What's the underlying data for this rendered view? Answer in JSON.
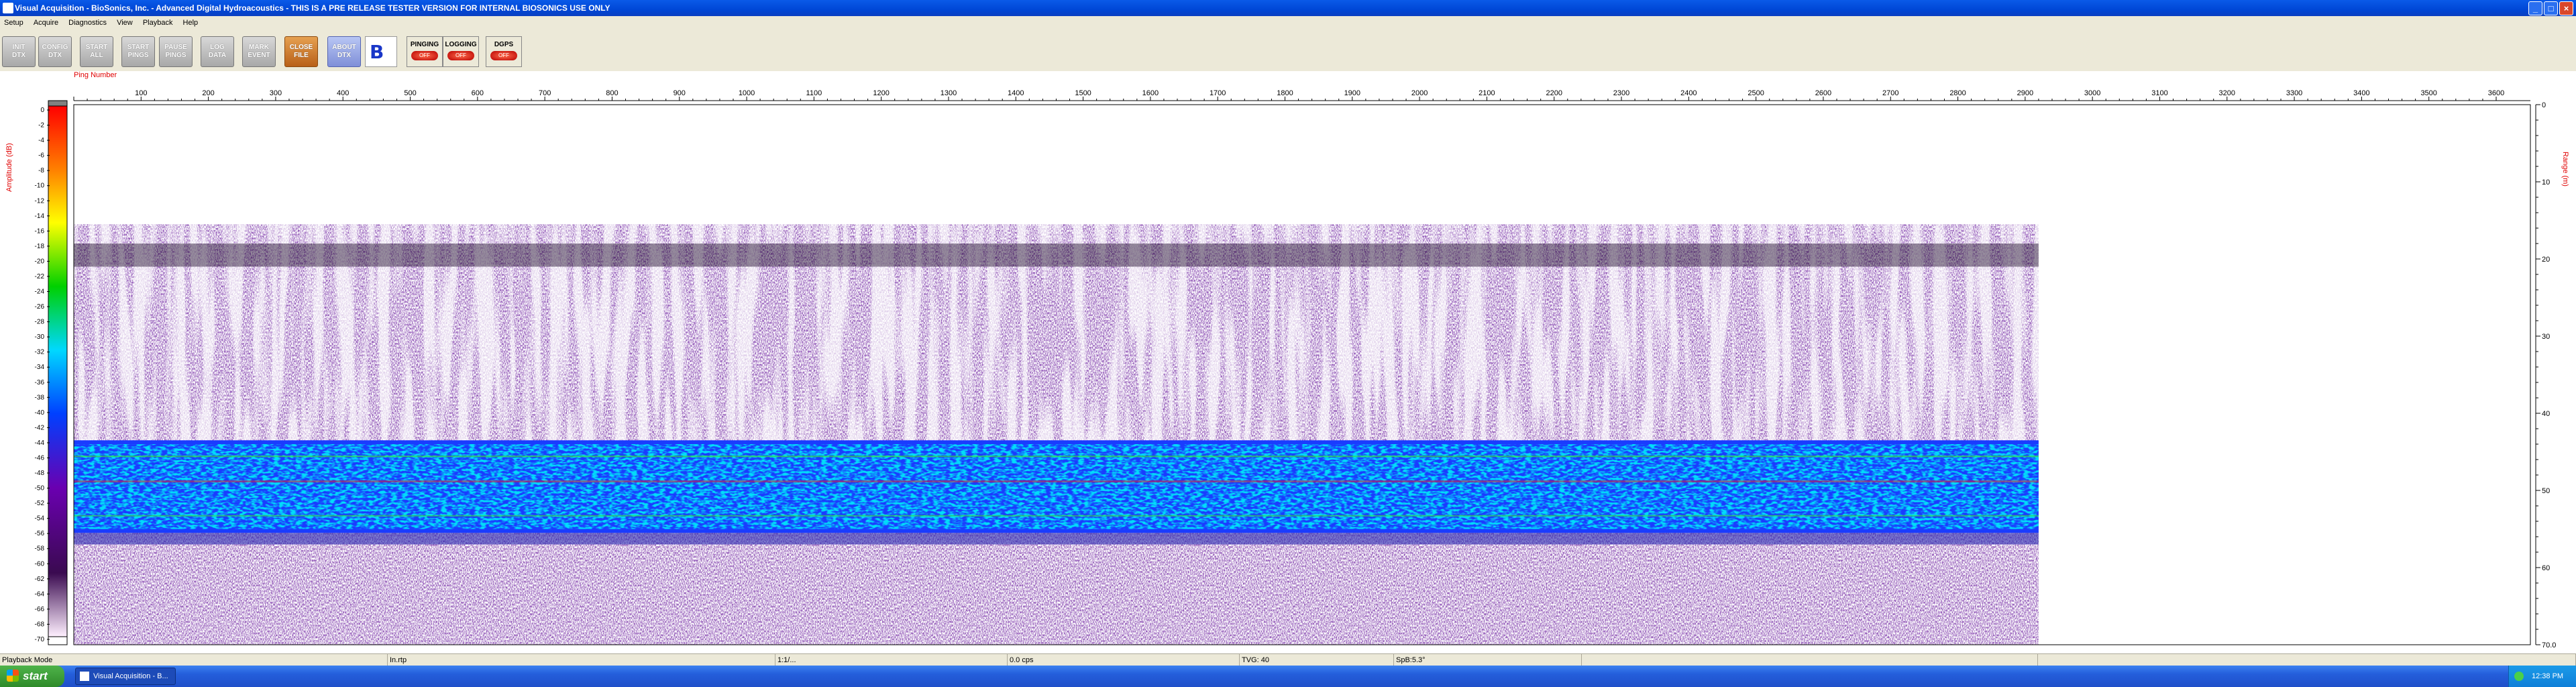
{
  "window": {
    "title": "Visual Acquisition  -  BioSonics, Inc.  -  Advanced Digital Hydroacoustics  -  THIS IS A PRE RELEASE TESTER VERSION FOR INTERNAL BIOSONICS USE ONLY",
    "buttons": {
      "minimize": "_",
      "maximize": "□",
      "close": "×"
    }
  },
  "menu": [
    "Setup",
    "Acquire",
    "Diagnostics",
    "View",
    "Playback",
    "Help"
  ],
  "toolbar": {
    "buttons": [
      "INIT\nDTX",
      "CONFIG\nDTX",
      "START\nALL",
      "START\nPINGS",
      "PAUSE\nPINGS",
      "LOG\nDATA",
      "MARK\nEVENT",
      "CLOSE\nFILE",
      "ABOUT\nDTX"
    ],
    "logo": "B",
    "status_buttons": [
      {
        "label": "PINGING",
        "state": "OFF"
      },
      {
        "label": "LOGGING",
        "state": "OFF"
      },
      {
        "label": "DGPS",
        "state": "OFF"
      }
    ]
  },
  "echogram": {
    "x_axis_title": "Ping Number",
    "x_ticks": [
      "100",
      "200",
      "300",
      "400",
      "500",
      "600",
      "700",
      "800",
      "900",
      "1000",
      "1100",
      "1200",
      "1300",
      "1400",
      "1500",
      "1600",
      "1700",
      "1800",
      "1900",
      "2000",
      "2100",
      "2200",
      "2300",
      "2400",
      "2500",
      "2600",
      "2700",
      "2800",
      "2900",
      "3000",
      "3100",
      "3200",
      "3300",
      "3400",
      "3500",
      "3600"
    ],
    "amplitude_title": "Amplitude (dB)",
    "amplitude_ticks": [
      "0",
      "-2",
      "-4",
      "-6",
      "-8",
      "-10",
      "-12",
      "-14",
      "-16",
      "-18",
      "-20",
      "-22",
      "-24",
      "-26",
      "-28",
      "-30",
      "-32",
      "-34",
      "-36",
      "-38",
      "-40",
      "-42",
      "-44",
      "-46",
      "-48",
      "-50",
      "-52",
      "-54",
      "-56",
      "-58",
      "-60",
      "-62",
      "-64",
      "-66",
      "-68",
      "-70"
    ],
    "range_title": "Range (m)",
    "range_ticks": [
      "0",
      "10",
      "20",
      "30",
      "40",
      "50",
      "60",
      "70.0"
    ],
    "colors": {
      "noise": "#4a1a7a",
      "band_blue": "#1a3cff",
      "band_cyan": "#00c8e8",
      "band_green": "#38e038",
      "band_red": "#d02040",
      "axis_label": "#e00000"
    }
  },
  "statusbar": {
    "mode": "Playback Mode",
    "cells": [
      "In.rtp",
      "1:1/...",
      "0.0 cps",
      "TVG: 40",
      "SpB:5.3°"
    ]
  },
  "taskbar": {
    "start_label": "start",
    "task_label": "Visual Acquisition - B...",
    "clock": "12:38 PM"
  }
}
